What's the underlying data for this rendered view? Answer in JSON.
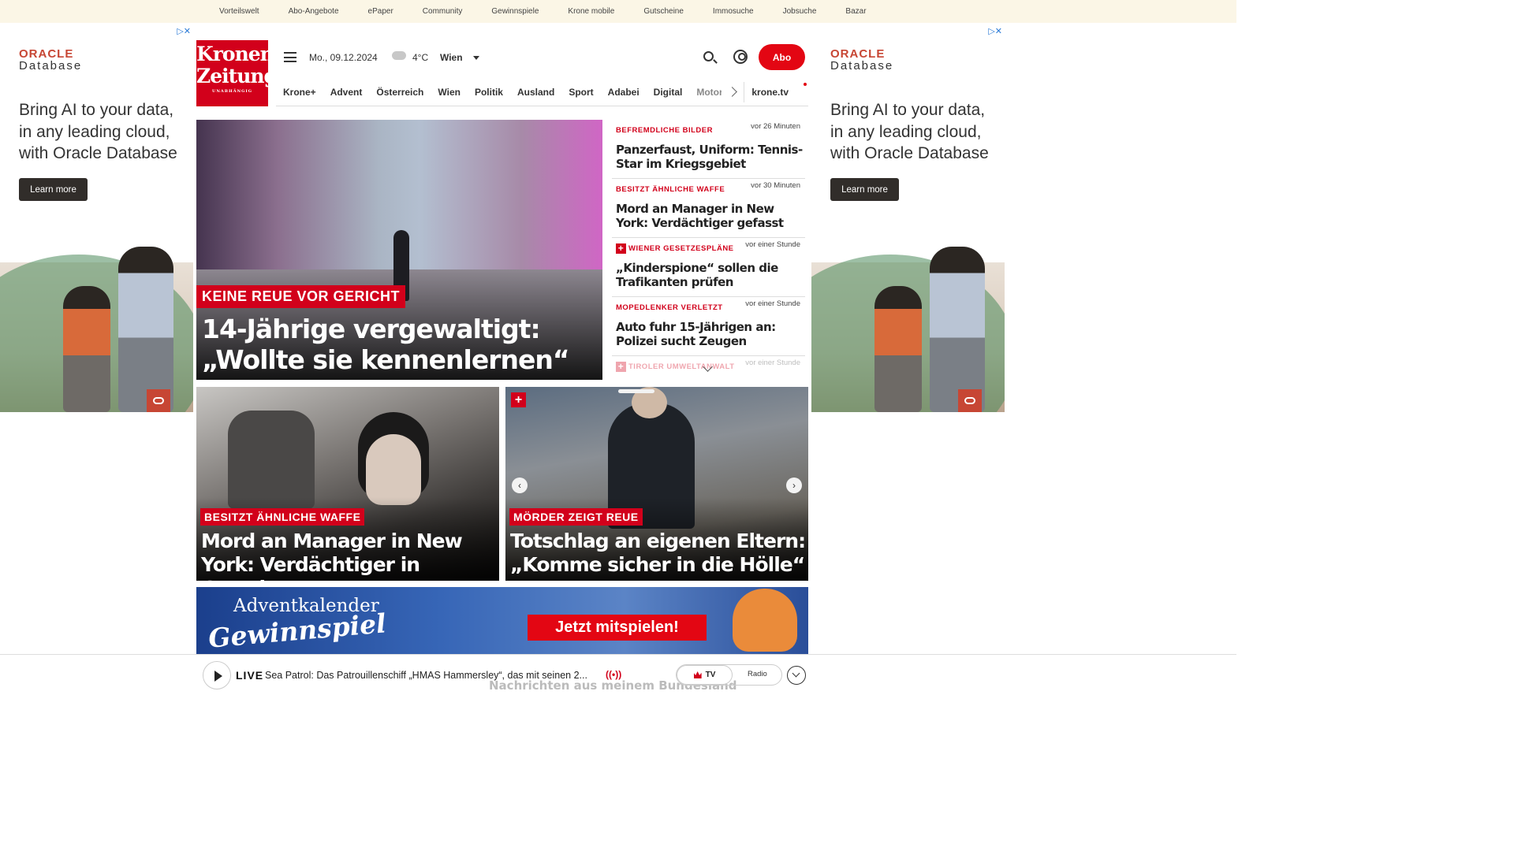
{
  "service_nav": [
    "Vorteilswelt",
    "Abo-Angebote",
    "ePaper",
    "Community",
    "Gewinnspiele",
    "Krone mobile",
    "Gutscheine",
    "Immosuche",
    "Jobsuche",
    "Bazar"
  ],
  "ad": {
    "brand_top": "ORACLE",
    "brand_bottom": "Database",
    "pitch": "Bring AI to your data, in any leading cloud, with Oracle Database",
    "cta": "Learn more",
    "adchoices": "▷✕"
  },
  "header": {
    "logo_line1": "Kronen",
    "logo_line2": "Zeitung",
    "logo_tag": "UNABHÄNGIG",
    "date": "Mo., 09.12.2024",
    "temperature": "4°C",
    "city": "Wien",
    "abo": "Abo"
  },
  "nav": [
    "Krone+",
    "Advent",
    "Österreich",
    "Wien",
    "Politik",
    "Ausland",
    "Sport",
    "Adabei",
    "Digital",
    "Motor"
  ],
  "nav_right": "krone.tv",
  "hero": {
    "kicker": "KEINE REUE VOR GERICHT",
    "headline": "14-Jährige vergewaltigt: „Wollte sie kennenlernen“"
  },
  "ticker": [
    {
      "kicker": "BEFREMDLICHE BILDER",
      "time": "vor 26 Minuten",
      "title": "Panzerfaust, Uniform: Tennis-Star im Kriegsgebiet",
      "plus": false
    },
    {
      "kicker": "BESITZT ÄHNLICHE WAFFE",
      "time": "vor 30 Minuten",
      "title": "Mord an Manager in New York: Verdächtiger gefasst",
      "plus": false
    },
    {
      "kicker": "WIENER GESETZESPLÄNE",
      "time": "vor einer Stunde",
      "title": "„Kinderspione“ sollen die Trafikanten prüfen",
      "plus": true
    },
    {
      "kicker": "MOPEDLENKER VERLETZT",
      "time": "vor einer Stunde",
      "title": "Auto fuhr 15-Jährigen an: Polizei sucht Zeugen",
      "plus": false
    },
    {
      "kicker": "TIROLER UMWELTANWALT",
      "time": "vor einer Stunde",
      "title": "",
      "plus": true
    }
  ],
  "cards": [
    {
      "kicker": "BESITZT ÄHNLICHE WAFFE",
      "headline": "Mord an Manager in New York: Verdächtiger in Gewahrsam"
    },
    {
      "kicker": "MÖRDER ZEIGT REUE",
      "headline": "Totschlag an eigenen Eltern: „Komme sicher in die Hölle“",
      "badge": "+"
    }
  ],
  "banner": {
    "line1": "Adventkalender",
    "line2": "Gewinnspiel",
    "cta": "Jetzt mitspielen!"
  },
  "player": {
    "live": "LIVE",
    "title": "Sea Patrol: Das Patrouillenschiff „HMAS Hammersley“, das mit seinen 2...",
    "tv": "TV",
    "radio": "Radio",
    "behind": "Nachrichten aus meinem Bundesland"
  }
}
